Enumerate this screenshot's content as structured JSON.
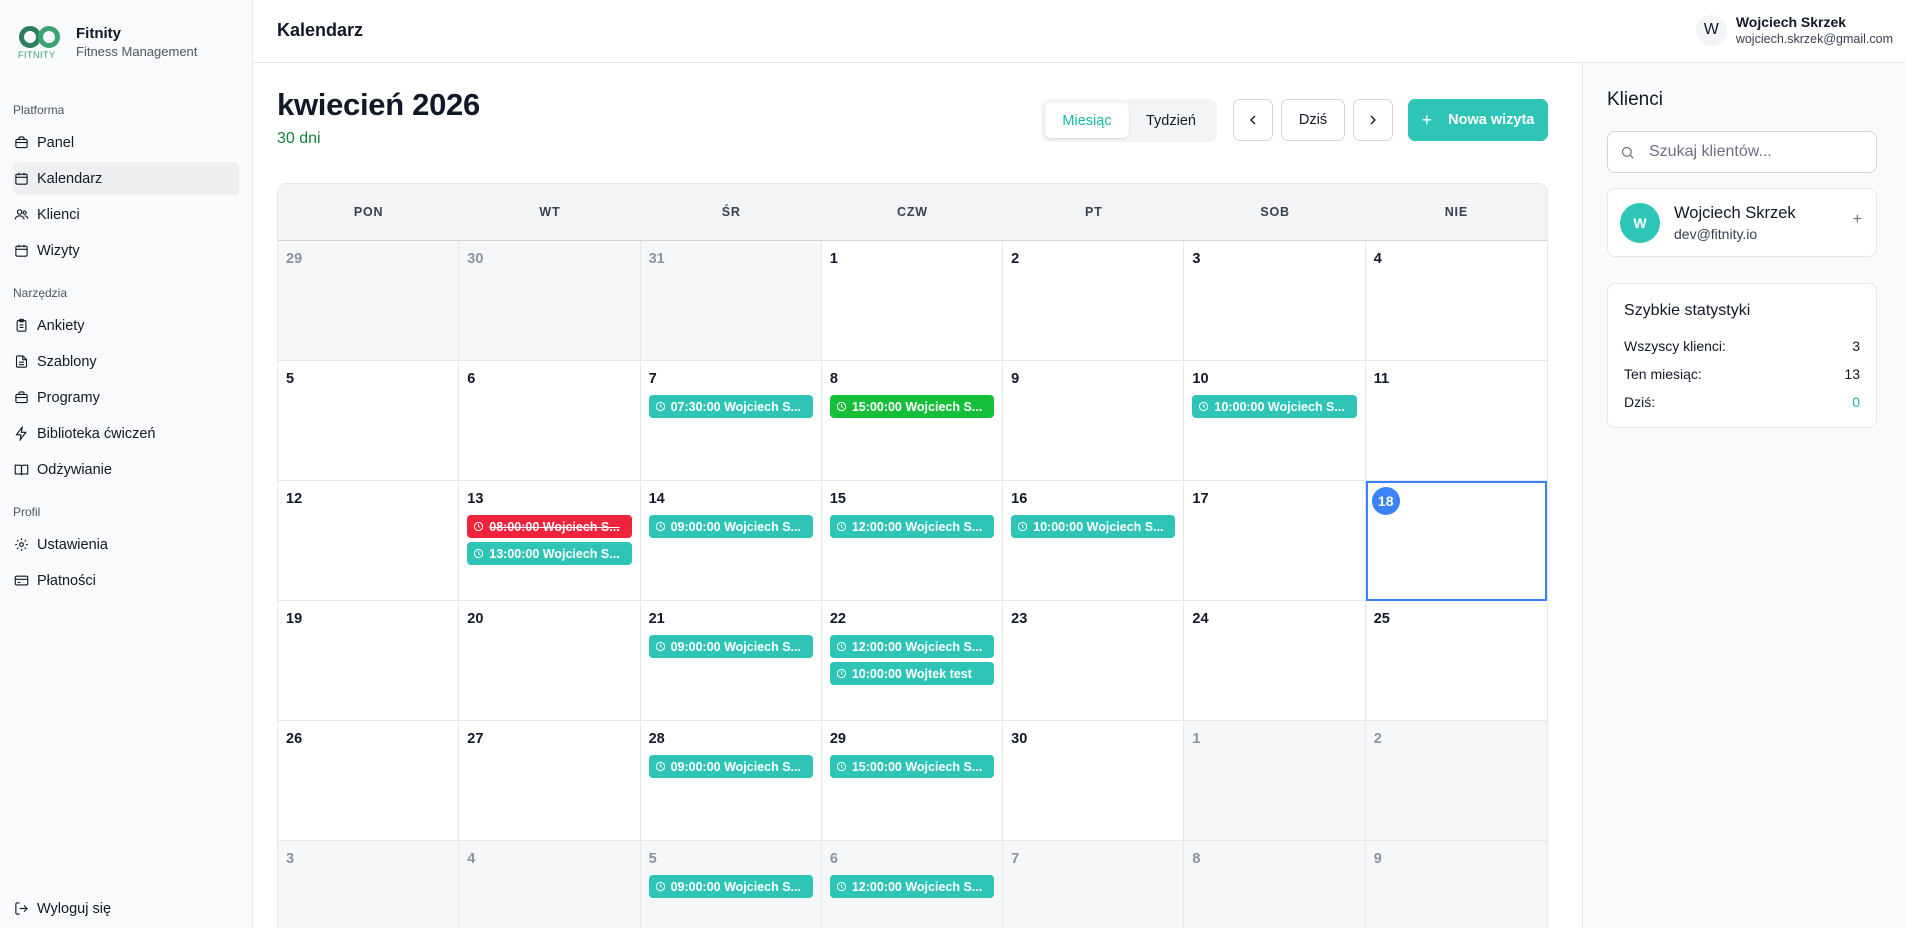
{
  "brand": {
    "name": "Fitnity",
    "subtitle": "Fitness Management",
    "logo_word": "FITNITY"
  },
  "sidebar": {
    "sections": [
      {
        "title": "Platforma",
        "items": [
          {
            "label": "Panel",
            "icon": "briefcase-icon"
          },
          {
            "label": "Kalendarz",
            "icon": "calendar-icon",
            "active": true
          },
          {
            "label": "Klienci",
            "icon": "users-icon"
          },
          {
            "label": "Wizyty",
            "icon": "calendar-icon"
          }
        ]
      },
      {
        "title": "Narzędzia",
        "items": [
          {
            "label": "Ankiety",
            "icon": "clipboard-icon"
          },
          {
            "label": "Szablony",
            "icon": "file-icon"
          },
          {
            "label": "Programy",
            "icon": "briefcase-icon"
          },
          {
            "label": "Biblioteka ćwiczeń",
            "icon": "bolt-icon"
          },
          {
            "label": "Odżywianie",
            "icon": "book-icon"
          }
        ]
      },
      {
        "title": "Profil",
        "items": [
          {
            "label": "Ustawienia",
            "icon": "gear-icon"
          },
          {
            "label": "Płatności",
            "icon": "card-icon"
          }
        ]
      }
    ],
    "logout_label": "Wyloguj się"
  },
  "topbar": {
    "title": "Kalendarz",
    "user": {
      "initial": "W",
      "name": "Wojciech Skrzek",
      "email": "wojciech.skrzek@gmail.com"
    }
  },
  "calendar": {
    "month_title": "kwiecień 2026",
    "days_count": "30 dni",
    "view_options": [
      "Miesiąc",
      "Tydzień"
    ],
    "active_view": "Miesiąc",
    "today_label": "Dziś",
    "new_visit_label": "Nowa wizyta",
    "weekdays": [
      "PON",
      "WT",
      "ŚR",
      "CZW",
      "PT",
      "SOB",
      "NIE"
    ],
    "accent_color": "#2ec4b6",
    "weeks": [
      [
        {
          "d": "29",
          "other": true
        },
        {
          "d": "30",
          "other": true
        },
        {
          "d": "31",
          "other": true
        },
        {
          "d": "1"
        },
        {
          "d": "2"
        },
        {
          "d": "3"
        },
        {
          "d": "4"
        }
      ],
      [
        {
          "d": "5"
        },
        {
          "d": "6"
        },
        {
          "d": "7",
          "events": [
            {
              "text": "07:30:00 Wojciech S...",
              "status": "teal"
            }
          ]
        },
        {
          "d": "8",
          "events": [
            {
              "text": "15:00:00 Wojciech S...",
              "status": "green"
            }
          ]
        },
        {
          "d": "9"
        },
        {
          "d": "10",
          "events": [
            {
              "text": "10:00:00 Wojciech S...",
              "status": "teal"
            }
          ]
        },
        {
          "d": "11"
        }
      ],
      [
        {
          "d": "12"
        },
        {
          "d": "13",
          "events": [
            {
              "text": "08:00:00 Wojciech S...",
              "status": "red"
            },
            {
              "text": "13:00:00 Wojciech S...",
              "status": "teal"
            }
          ]
        },
        {
          "d": "14",
          "events": [
            {
              "text": "09:00:00 Wojciech S...",
              "status": "teal"
            }
          ]
        },
        {
          "d": "15",
          "events": [
            {
              "text": "12:00:00 Wojciech S...",
              "status": "teal"
            }
          ]
        },
        {
          "d": "16",
          "events": [
            {
              "text": "10:00:00 Wojciech S...",
              "status": "teal"
            }
          ]
        },
        {
          "d": "17"
        },
        {
          "d": "18",
          "today": true
        }
      ],
      [
        {
          "d": "19"
        },
        {
          "d": "20"
        },
        {
          "d": "21",
          "events": [
            {
              "text": "09:00:00 Wojciech S...",
              "status": "teal"
            }
          ]
        },
        {
          "d": "22",
          "events": [
            {
              "text": "12:00:00 Wojciech S...",
              "status": "teal"
            },
            {
              "text": "10:00:00 Wojtek test",
              "status": "teal"
            }
          ]
        },
        {
          "d": "23"
        },
        {
          "d": "24"
        },
        {
          "d": "25"
        }
      ],
      [
        {
          "d": "26"
        },
        {
          "d": "27"
        },
        {
          "d": "28",
          "events": [
            {
              "text": "09:00:00 Wojciech S...",
              "status": "teal"
            }
          ]
        },
        {
          "d": "29",
          "events": [
            {
              "text": "15:00:00 Wojciech S...",
              "status": "teal"
            }
          ]
        },
        {
          "d": "30"
        },
        {
          "d": "1",
          "other": true
        },
        {
          "d": "2",
          "other": true
        }
      ],
      [
        {
          "d": "3",
          "other": true
        },
        {
          "d": "4",
          "other": true
        },
        {
          "d": "5",
          "other": true,
          "events": [
            {
              "text": "09:00:00 Wojciech S...",
              "status": "teal"
            }
          ]
        },
        {
          "d": "6",
          "other": true,
          "events": [
            {
              "text": "12:00:00 Wojciech S...",
              "status": "teal"
            }
          ]
        },
        {
          "d": "7",
          "other": true
        },
        {
          "d": "8",
          "other": true
        },
        {
          "d": "9",
          "other": true
        }
      ]
    ]
  },
  "clients_panel": {
    "title": "Klienci",
    "search_placeholder": "Szukaj klientów...",
    "clients": [
      {
        "initial": "W",
        "name": "Wojciech Skrzek",
        "email": "dev@fitnity.io",
        "action": "+"
      }
    ],
    "stats": {
      "title": "Szybkie statystyki",
      "rows": [
        {
          "label": "Wszyscy klienci:",
          "value": "3"
        },
        {
          "label": "Ten miesiąc:",
          "value": "13"
        },
        {
          "label": "Dziś:",
          "value": "0",
          "highlight": true
        }
      ]
    }
  }
}
